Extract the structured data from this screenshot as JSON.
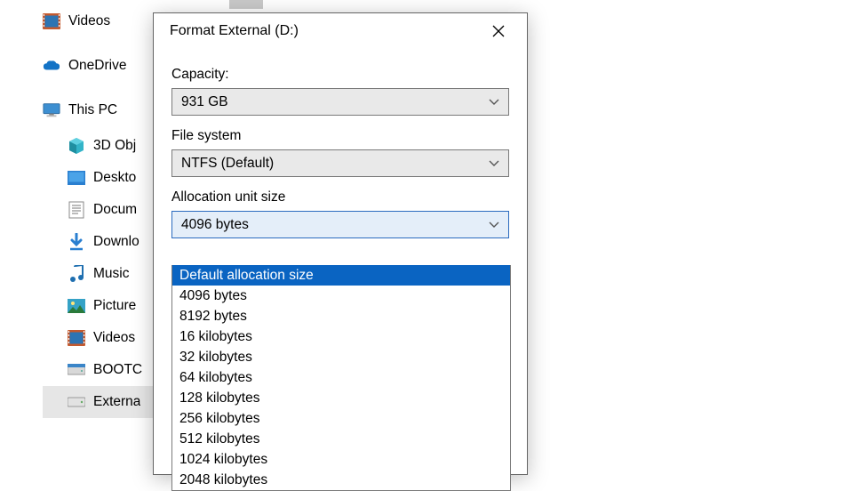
{
  "tree": {
    "items": [
      {
        "label": "Videos",
        "icon": "video-icon",
        "indent": false
      },
      {
        "label": "OneDrive",
        "icon": "onedrive-icon",
        "indent": false
      },
      {
        "label": "This PC",
        "icon": "this-pc-icon",
        "indent": false
      },
      {
        "label": "3D Obj",
        "icon": "3d-objects-icon",
        "indent": true
      },
      {
        "label": "Deskto",
        "icon": "desktop-icon",
        "indent": true
      },
      {
        "label": "Docum",
        "icon": "documents-icon",
        "indent": true
      },
      {
        "label": "Downlo",
        "icon": "downloads-icon",
        "indent": true
      },
      {
        "label": "Music",
        "icon": "music-icon",
        "indent": true
      },
      {
        "label": "Picture",
        "icon": "pictures-icon",
        "indent": true
      },
      {
        "label": "Videos",
        "icon": "video-icon",
        "indent": true
      },
      {
        "label": "BOOTC",
        "icon": "drive-icon",
        "indent": true
      },
      {
        "label": "Externa",
        "icon": "external-drive-icon",
        "indent": true,
        "selected": true
      }
    ]
  },
  "dialog": {
    "title": "Format External (D:)",
    "capacity": {
      "label": "Capacity:",
      "value": "931 GB"
    },
    "filesystem": {
      "label": "File system",
      "value": "NTFS (Default)"
    },
    "allocation": {
      "label": "Allocation unit size",
      "value": "4096 bytes",
      "options": [
        "Default allocation size",
        "4096 bytes",
        "8192 bytes",
        "16 kilobytes",
        "32 kilobytes",
        "64 kilobytes",
        "128 kilobytes",
        "256 kilobytes",
        "512 kilobytes",
        "1024 kilobytes",
        "2048 kilobytes"
      ],
      "highlighted_index": 0
    }
  },
  "colors": {
    "highlight": "#0a64c2",
    "combo_open": "#e4eef9"
  }
}
